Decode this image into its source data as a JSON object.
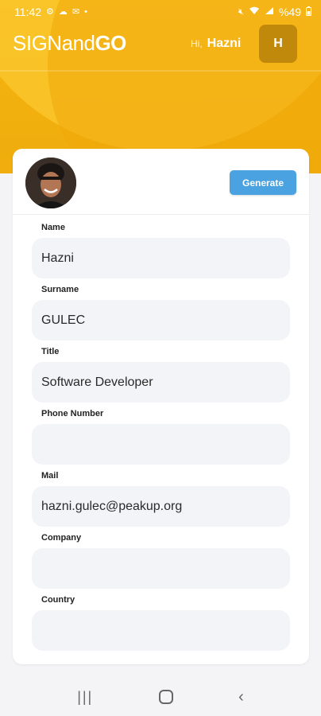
{
  "status_bar": {
    "time": "11:42",
    "left_icons": [
      "settings-icon",
      "cloud-icon",
      "mail-icon",
      "dot-icon"
    ],
    "battery": "%49",
    "right_icons": [
      "mute-icon",
      "wifi-icon",
      "signal-icon",
      "battery-icon"
    ]
  },
  "app_bar": {
    "logo_main": "SIGNand",
    "logo_accent": "GO",
    "greeting_prefix": "Hi,",
    "user_name": "Hazni",
    "avatar_initial": "H"
  },
  "profile": {
    "generate_label": "Generate"
  },
  "form": {
    "fields": [
      {
        "label": "Name",
        "value": "Hazni"
      },
      {
        "label": "Surname",
        "value": "GULEC"
      },
      {
        "label": "Title",
        "value": "Software Developer"
      },
      {
        "label": "Phone Number",
        "value": ""
      },
      {
        "label": "Mail",
        "value": "hazni.gulec@peakup.org"
      },
      {
        "label": "Company",
        "value": ""
      },
      {
        "label": "Country",
        "value": ""
      }
    ]
  },
  "colors": {
    "header": "#f0ad0d",
    "accent_button": "#4aa3e0",
    "avatar_bg": "#c0890c",
    "input_bg": "#f3f4f8"
  }
}
